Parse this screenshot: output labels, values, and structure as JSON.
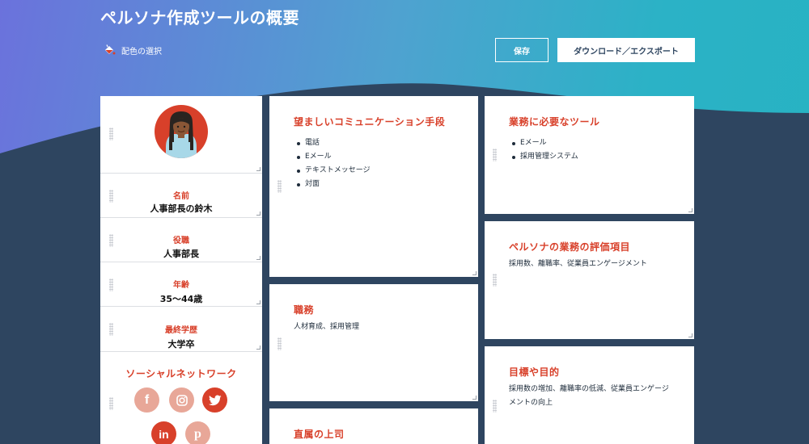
{
  "header": {
    "title": "ペルソナ作成ツールの概要",
    "color_pick_label": "配色の選択",
    "save_label": "保存",
    "download_label": "ダウンロード／エクスポート"
  },
  "profile": {
    "fields": [
      {
        "label": "名前",
        "value": "人事部長の鈴木"
      },
      {
        "label": "役職",
        "value": "人事部長"
      },
      {
        "label": "年齢",
        "value": "35〜44歳"
      },
      {
        "label": "最終学歴",
        "value": "大学卒"
      }
    ],
    "social_title": "ソーシャルネットワーク",
    "social_links": [
      {
        "icon": "facebook-icon",
        "glyph": "f",
        "color": "#e8a798"
      },
      {
        "icon": "instagram-icon",
        "glyph": "◎",
        "color": "#e8a798"
      },
      {
        "icon": "twitter-icon",
        "glyph": "🐦",
        "color": "#d8402a"
      },
      {
        "icon": "linkedin-icon",
        "glyph": "in",
        "color": "#d8402a"
      },
      {
        "icon": "pinterest-icon",
        "glyph": "p",
        "color": "#e8a798"
      }
    ]
  },
  "cards": {
    "communication": {
      "title": "望ましいコミュニケーション手段",
      "items": [
        "電話",
        "Eメール",
        "テキストメッセージ",
        "対面"
      ]
    },
    "duties": {
      "title": "職務",
      "text": "人材育成、採用管理"
    },
    "boss": {
      "title": "直属の上司"
    },
    "tools": {
      "title": "業務に必要なツール",
      "items": [
        "Eメール",
        "採用管理システム"
      ]
    },
    "evaluation": {
      "title": "ペルソナの業務の評価項目",
      "text": "採用数、離職率、従業員エンゲージメント"
    },
    "goals": {
      "title": "目標や目的",
      "text": "採用数の増加、離職率の低減、従業員エンゲージメントの向上"
    }
  },
  "colors": {
    "accent": "#d8402a",
    "accent_light": "#e8a798",
    "navy": "#2e4560"
  }
}
